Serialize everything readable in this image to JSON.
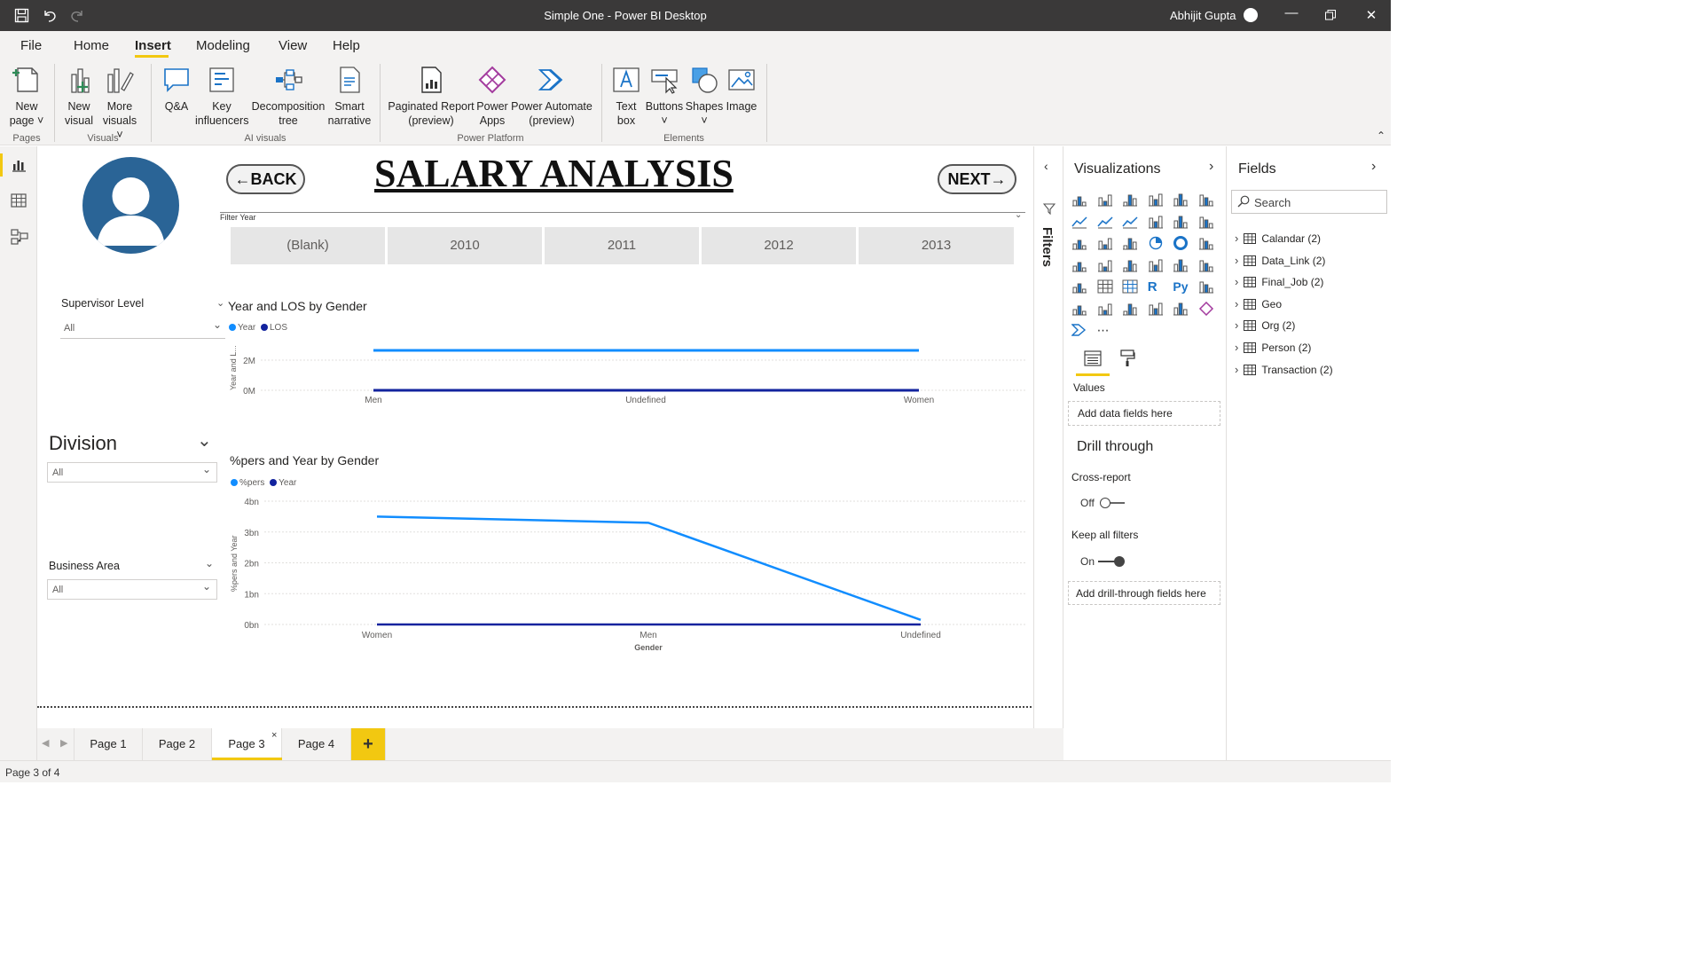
{
  "window": {
    "title": "Simple One - Power BI Desktop",
    "user": "Abhijit Gupta"
  },
  "menu": {
    "tabs": [
      "File",
      "Home",
      "Insert",
      "Modeling",
      "View",
      "Help"
    ],
    "active": "Insert"
  },
  "ribbon": {
    "new_page": [
      "New",
      "page"
    ],
    "new_visual": [
      "New",
      "visual"
    ],
    "more_visuals": [
      "More",
      "visuals"
    ],
    "qa": "Q&A",
    "key_influencers": [
      "Key",
      "influencers"
    ],
    "decomposition_tree": [
      "Decomposition",
      "tree"
    ],
    "smart_narrative": [
      "Smart",
      "narrative"
    ],
    "paginated_report": [
      "Paginated Report",
      "(preview)"
    ],
    "power_apps": [
      "Power",
      "Apps"
    ],
    "power_automate": [
      "Power Automate",
      "(preview)"
    ],
    "text_box": [
      "Text",
      "box"
    ],
    "buttons": "Buttons",
    "shapes": "Shapes",
    "image": "Image",
    "groups": {
      "pages": "Pages",
      "visuals": "Visuals",
      "ai_visuals": "AI visuals",
      "power_platform": "Power Platform",
      "elements": "Elements"
    }
  },
  "report": {
    "title": "SALARY ANALYSIS",
    "back_label": "←BACK",
    "next_label": "NEXT→",
    "filter_year_label": "Filter Year",
    "year_tiles": [
      "(Blank)",
      "2010",
      "2011",
      "2012",
      "2013"
    ],
    "supervisor_level": {
      "title": "Supervisor Level",
      "value": "All"
    },
    "division": {
      "title": "Division",
      "value": "All"
    },
    "business_area": {
      "title": "Business Area",
      "value": "All"
    }
  },
  "chart_data": [
    {
      "type": "line",
      "title": "Year and LOS by Gender",
      "ylabel": "Year and L...",
      "categories": [
        "Men",
        "Undefined",
        "Women"
      ],
      "yticks": [
        "2M",
        "0M"
      ],
      "series": [
        {
          "name": "Year",
          "color": "#118dff",
          "values": [
            3600000,
            3600000,
            3600000
          ]
        },
        {
          "name": "LOS",
          "color": "#12239e",
          "values": [
            0,
            0,
            0
          ]
        }
      ]
    },
    {
      "type": "line",
      "title": "%pers and Year by Gender",
      "xlabel": "Gender",
      "ylabel": "%pers and Year",
      "categories": [
        "Women",
        "Men",
        "Undefined"
      ],
      "yticks": [
        "4bn",
        "3bn",
        "2bn",
        "1bn",
        "0bn"
      ],
      "ylim": [
        0,
        4
      ],
      "series": [
        {
          "name": "%pers",
          "color": "#118dff",
          "values": [
            3.5,
            3.3,
            0.15
          ]
        },
        {
          "name": "Year",
          "color": "#12239e",
          "values": [
            0,
            0,
            0
          ]
        }
      ]
    }
  ],
  "filters_pane": {
    "label": "Filters"
  },
  "visualizations": {
    "title": "Visualizations",
    "values_label": "Values",
    "add_fields": "Add data fields here",
    "drill_title": "Drill through",
    "cross_report": "Cross-report",
    "cross_report_state": "Off",
    "keep_filters": "Keep all filters",
    "keep_filters_state": "On",
    "add_drill": "Add drill-through fields here"
  },
  "fields": {
    "title": "Fields",
    "search_placeholder": "Search",
    "tables": [
      "Calandar (2)",
      "Data_Link (2)",
      "Final_Job (2)",
      "Geo",
      "Org (2)",
      "Person (2)",
      "Transaction (2)"
    ]
  },
  "pages": {
    "tabs": [
      "Page 1",
      "Page 2",
      "Page 3",
      "Page 4"
    ],
    "active": "Page 3",
    "add": "+"
  },
  "status": {
    "text": "Page 3 of 4"
  },
  "colors": {
    "accent": "#f2c811",
    "series_light": "#118dff",
    "series_dark": "#12239e"
  }
}
